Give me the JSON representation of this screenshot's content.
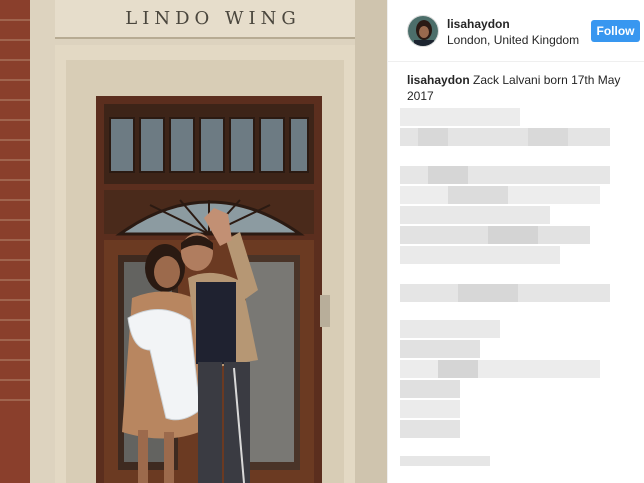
{
  "photo": {
    "alt_subject": "building-entrance-photo",
    "sign_text": "LINDO WING"
  },
  "post": {
    "username": "lisahaydon",
    "location": "London, United Kingdom",
    "follow_label": "Follow",
    "caption_username": "lisahaydon",
    "caption_text": " Zack Lalvani born 17th May 2017"
  },
  "colors": {
    "accent": "#3897f0",
    "text": "#262626",
    "border": "#efefef"
  }
}
